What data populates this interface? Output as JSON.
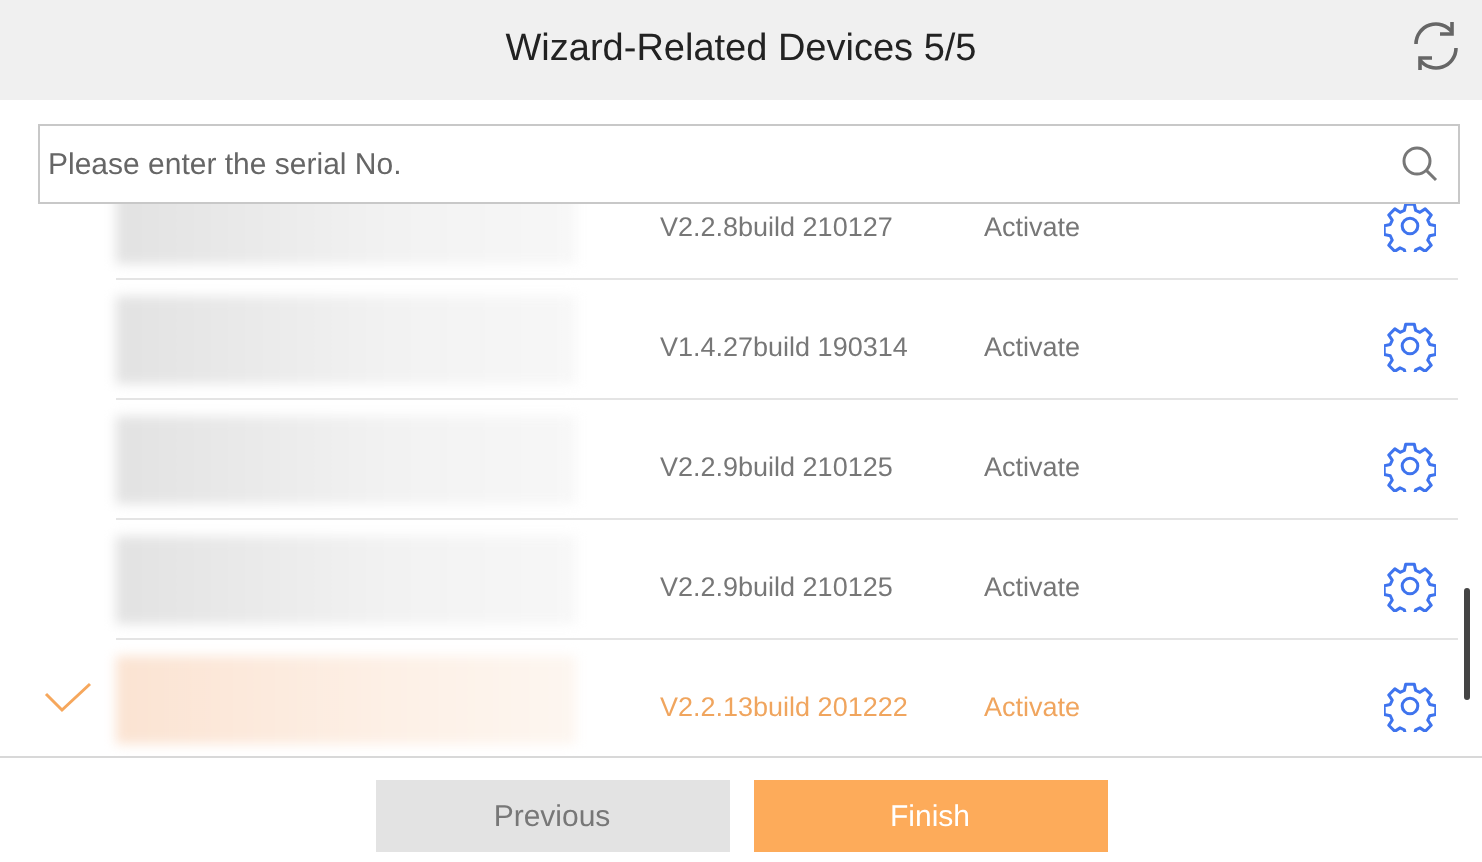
{
  "header": {
    "title": "Wizard-Related Devices 5/5"
  },
  "search": {
    "placeholder": "Please enter the serial No."
  },
  "devices": [
    {
      "version": "V2.2.8build 210127",
      "status": "Activate",
      "selected": false
    },
    {
      "version": "V1.4.27build 190314",
      "status": "Activate",
      "selected": false
    },
    {
      "version": "V2.2.9build 210125",
      "status": "Activate",
      "selected": false
    },
    {
      "version": "V2.2.9build 210125",
      "status": "Activate",
      "selected": false
    },
    {
      "version": "V2.2.13build 201222",
      "status": "Activate",
      "selected": true
    }
  ],
  "buttons": [
    {
      "label": "Previous",
      "kind": "secondary"
    },
    {
      "label": "Finish",
      "kind": "primary"
    }
  ]
}
